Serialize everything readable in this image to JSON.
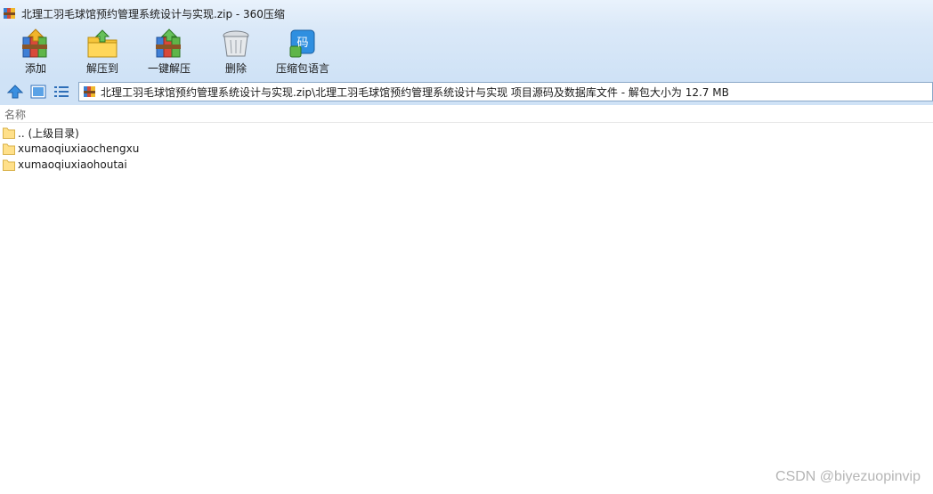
{
  "window": {
    "title": "北理工羽毛球馆预约管理系统设计与实现.zip - 360压缩"
  },
  "toolbar": {
    "items": [
      {
        "label": "添加",
        "icon": "books-add-icon"
      },
      {
        "label": "解压到",
        "icon": "folder-extract-icon"
      },
      {
        "label": "一键解压",
        "icon": "books-extract-icon"
      },
      {
        "label": "删除",
        "icon": "trash-can-icon"
      },
      {
        "label": "压缩包语言",
        "icon": "encoding-icon",
        "badge": "码"
      }
    ]
  },
  "nav": {
    "path": "北理工羽毛球馆预约管理系统设计与实现.zip\\北理工羽毛球馆预约管理系统设计与实现 项目源码及数据库文件 - 解包大小为 12.7 MB"
  },
  "list": {
    "column_name": "名称",
    "rows": [
      {
        "name": ".. (上级目录)"
      },
      {
        "name": "xumaoqiuxiaochengxu"
      },
      {
        "name": "xumaoqiuxiaohoutai"
      }
    ]
  },
  "watermark": "CSDN @biyezuopinvip",
  "colors": {
    "chrome": "#cfe2f6",
    "folder": "#ffe08a",
    "accent": "#2f8fe0"
  }
}
